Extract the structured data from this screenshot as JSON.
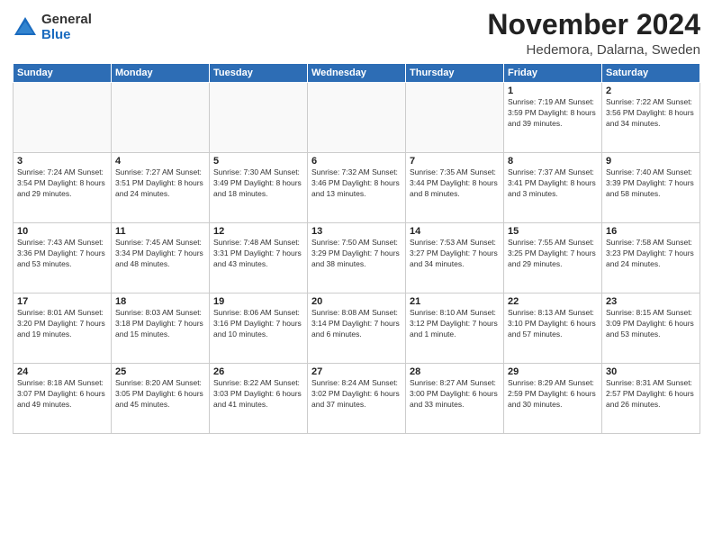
{
  "logo": {
    "general": "General",
    "blue": "Blue"
  },
  "title": "November 2024",
  "location": "Hedemora, Dalarna, Sweden",
  "weekdays": [
    "Sunday",
    "Monday",
    "Tuesday",
    "Wednesday",
    "Thursday",
    "Friday",
    "Saturday"
  ],
  "weeks": [
    [
      {
        "day": "",
        "info": ""
      },
      {
        "day": "",
        "info": ""
      },
      {
        "day": "",
        "info": ""
      },
      {
        "day": "",
        "info": ""
      },
      {
        "day": "",
        "info": ""
      },
      {
        "day": "1",
        "info": "Sunrise: 7:19 AM\nSunset: 3:59 PM\nDaylight: 8 hours\nand 39 minutes."
      },
      {
        "day": "2",
        "info": "Sunrise: 7:22 AM\nSunset: 3:56 PM\nDaylight: 8 hours\nand 34 minutes."
      }
    ],
    [
      {
        "day": "3",
        "info": "Sunrise: 7:24 AM\nSunset: 3:54 PM\nDaylight: 8 hours\nand 29 minutes."
      },
      {
        "day": "4",
        "info": "Sunrise: 7:27 AM\nSunset: 3:51 PM\nDaylight: 8 hours\nand 24 minutes."
      },
      {
        "day": "5",
        "info": "Sunrise: 7:30 AM\nSunset: 3:49 PM\nDaylight: 8 hours\nand 18 minutes."
      },
      {
        "day": "6",
        "info": "Sunrise: 7:32 AM\nSunset: 3:46 PM\nDaylight: 8 hours\nand 13 minutes."
      },
      {
        "day": "7",
        "info": "Sunrise: 7:35 AM\nSunset: 3:44 PM\nDaylight: 8 hours\nand 8 minutes."
      },
      {
        "day": "8",
        "info": "Sunrise: 7:37 AM\nSunset: 3:41 PM\nDaylight: 8 hours\nand 3 minutes."
      },
      {
        "day": "9",
        "info": "Sunrise: 7:40 AM\nSunset: 3:39 PM\nDaylight: 7 hours\nand 58 minutes."
      }
    ],
    [
      {
        "day": "10",
        "info": "Sunrise: 7:43 AM\nSunset: 3:36 PM\nDaylight: 7 hours\nand 53 minutes."
      },
      {
        "day": "11",
        "info": "Sunrise: 7:45 AM\nSunset: 3:34 PM\nDaylight: 7 hours\nand 48 minutes."
      },
      {
        "day": "12",
        "info": "Sunrise: 7:48 AM\nSunset: 3:31 PM\nDaylight: 7 hours\nand 43 minutes."
      },
      {
        "day": "13",
        "info": "Sunrise: 7:50 AM\nSunset: 3:29 PM\nDaylight: 7 hours\nand 38 minutes."
      },
      {
        "day": "14",
        "info": "Sunrise: 7:53 AM\nSunset: 3:27 PM\nDaylight: 7 hours\nand 34 minutes."
      },
      {
        "day": "15",
        "info": "Sunrise: 7:55 AM\nSunset: 3:25 PM\nDaylight: 7 hours\nand 29 minutes."
      },
      {
        "day": "16",
        "info": "Sunrise: 7:58 AM\nSunset: 3:23 PM\nDaylight: 7 hours\nand 24 minutes."
      }
    ],
    [
      {
        "day": "17",
        "info": "Sunrise: 8:01 AM\nSunset: 3:20 PM\nDaylight: 7 hours\nand 19 minutes."
      },
      {
        "day": "18",
        "info": "Sunrise: 8:03 AM\nSunset: 3:18 PM\nDaylight: 7 hours\nand 15 minutes."
      },
      {
        "day": "19",
        "info": "Sunrise: 8:06 AM\nSunset: 3:16 PM\nDaylight: 7 hours\nand 10 minutes."
      },
      {
        "day": "20",
        "info": "Sunrise: 8:08 AM\nSunset: 3:14 PM\nDaylight: 7 hours\nand 6 minutes."
      },
      {
        "day": "21",
        "info": "Sunrise: 8:10 AM\nSunset: 3:12 PM\nDaylight: 7 hours\nand 1 minute."
      },
      {
        "day": "22",
        "info": "Sunrise: 8:13 AM\nSunset: 3:10 PM\nDaylight: 6 hours\nand 57 minutes."
      },
      {
        "day": "23",
        "info": "Sunrise: 8:15 AM\nSunset: 3:09 PM\nDaylight: 6 hours\nand 53 minutes."
      }
    ],
    [
      {
        "day": "24",
        "info": "Sunrise: 8:18 AM\nSunset: 3:07 PM\nDaylight: 6 hours\nand 49 minutes."
      },
      {
        "day": "25",
        "info": "Sunrise: 8:20 AM\nSunset: 3:05 PM\nDaylight: 6 hours\nand 45 minutes."
      },
      {
        "day": "26",
        "info": "Sunrise: 8:22 AM\nSunset: 3:03 PM\nDaylight: 6 hours\nand 41 minutes."
      },
      {
        "day": "27",
        "info": "Sunrise: 8:24 AM\nSunset: 3:02 PM\nDaylight: 6 hours\nand 37 minutes."
      },
      {
        "day": "28",
        "info": "Sunrise: 8:27 AM\nSunset: 3:00 PM\nDaylight: 6 hours\nand 33 minutes."
      },
      {
        "day": "29",
        "info": "Sunrise: 8:29 AM\nSunset: 2:59 PM\nDaylight: 6 hours\nand 30 minutes."
      },
      {
        "day": "30",
        "info": "Sunrise: 8:31 AM\nSunset: 2:57 PM\nDaylight: 6 hours\nand 26 minutes."
      }
    ]
  ]
}
